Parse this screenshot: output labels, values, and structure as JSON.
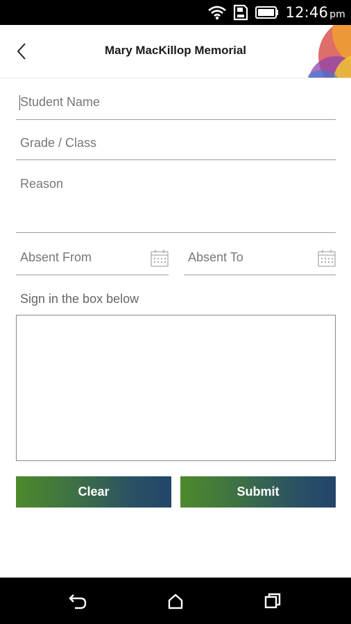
{
  "status_bar": {
    "time": "12:46",
    "ampm": "pm",
    "icons": [
      "wifi-icon",
      "sd-card-icon",
      "battery-icon"
    ]
  },
  "header": {
    "title": "Mary MacKillop Memorial",
    "back_icon": "chevron-left-icon"
  },
  "form": {
    "student_name_placeholder": "Student Name",
    "grade_class_placeholder": "Grade / Class",
    "reason_placeholder": "Reason",
    "absent_from_placeholder": "Absent From",
    "absent_to_placeholder": "Absent To",
    "calendar_icon": "calendar-icon",
    "sign_label": "Sign in the box below"
  },
  "buttons": {
    "clear_label": "Clear",
    "submit_label": "Submit"
  },
  "nav_bar": {
    "icons": [
      "back-arrow-icon",
      "home-icon",
      "recents-icon"
    ]
  },
  "colors": {
    "button_gradient_start": "#4d8a2c",
    "button_gradient_end": "#23456a",
    "status_bar": "#000000",
    "field_line": "#9a9a9a"
  }
}
